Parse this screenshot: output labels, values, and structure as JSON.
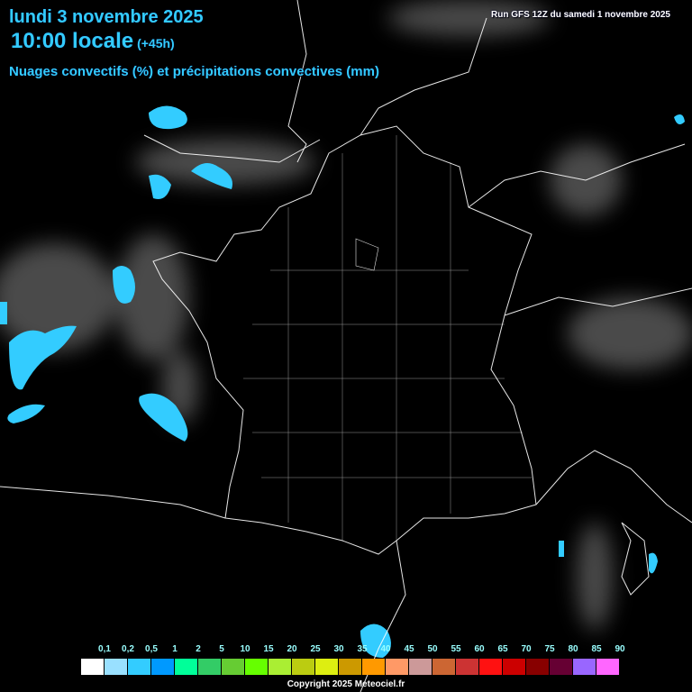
{
  "header": {
    "date": "lundi 3 novembre 2025",
    "time": "10:00 locale",
    "lead": "(+45h)",
    "subtitle": "Nuages convectifs (%) et précipitations convectives (mm)",
    "run": "Run GFS 12Z du samedi 1 novembre 2025"
  },
  "legend": {
    "labels": [
      "0,1",
      "0,2",
      "0,5",
      "1",
      "2",
      "5",
      "10",
      "15",
      "20",
      "25",
      "30",
      "35",
      "40",
      "45",
      "50",
      "55",
      "60",
      "65",
      "70",
      "75",
      "80",
      "85",
      "90"
    ],
    "colors": [
      "#ffffff",
      "#99e0ff",
      "#33ccff",
      "#0099ff",
      "#00ff99",
      "#33cc66",
      "#66cc33",
      "#66ff00",
      "#aaee33",
      "#bbcc11",
      "#ddee11",
      "#cc9900",
      "#ff9900",
      "#ff9966",
      "#cc9999",
      "#cc6633",
      "#cc3333",
      "#ff1111",
      "#cc0000",
      "#880000",
      "#660033",
      "#9966ff",
      "#ff66ff"
    ]
  },
  "copyright": "Copyright 2025 Meteociel.fr",
  "colors": {
    "title": "#33ccff",
    "background": "#000000",
    "borders": "#ffffff"
  }
}
